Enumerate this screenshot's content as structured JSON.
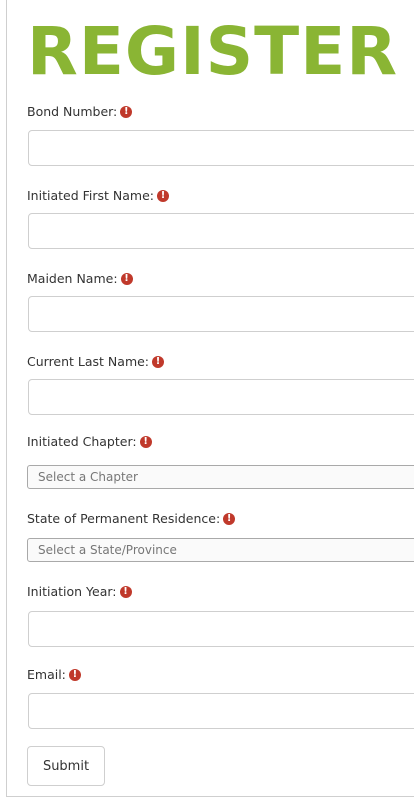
{
  "form": {
    "title": "REGISTER",
    "title_color": "#8ab534",
    "required_icon": "exclamation-circle-icon",
    "required_icon_glyph": "!",
    "required_color": "#c0392b",
    "fields": {
      "bond_number": {
        "label": "Bond Number:",
        "value": ""
      },
      "initiated_first_name": {
        "label": "Initiated First Name:",
        "value": ""
      },
      "maiden_name": {
        "label": "Maiden Name:",
        "value": ""
      },
      "current_last_name": {
        "label": "Current Last Name:",
        "value": ""
      },
      "initiated_chapter": {
        "label": "Initiated Chapter:",
        "selected": "Select a Chapter"
      },
      "state_residence": {
        "label": "State of Permanent Residence:",
        "selected": "Select a State/Province"
      },
      "initiation_year": {
        "label": "Initiation Year:",
        "value": ""
      },
      "email": {
        "label": "Email:",
        "value": ""
      }
    },
    "submit_label": "Submit"
  }
}
